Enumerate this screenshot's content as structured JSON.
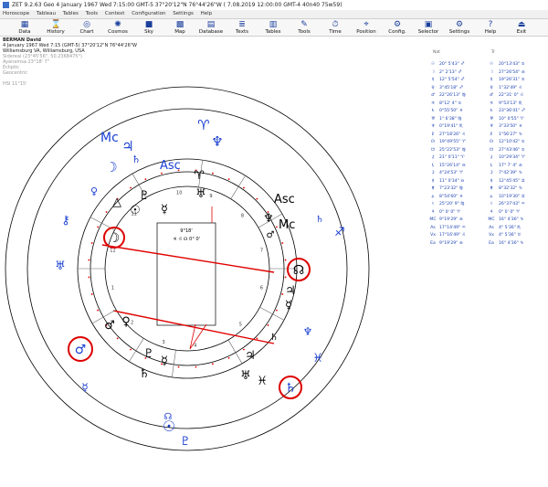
{
  "window": {
    "title": "ZET 9.2.63 Geo    4 January 1967  Wed    7:15:00 GMT-5 37°20'12\"N  76°44'26\"W   ( 7.08.2019  12:00:00 GMT-4 40n40 75w59)"
  },
  "menu": [
    "Horoscope",
    "Tableau",
    "Tables",
    "Tools",
    "Context",
    "Configuration",
    "Settings",
    "Help"
  ],
  "toolbar": [
    {
      "label": "Data",
      "icon": "data-icon",
      "glyph": "▦"
    },
    {
      "label": "History",
      "icon": "history-icon",
      "glyph": "⌛"
    },
    {
      "label": "Chart",
      "icon": "chart-icon",
      "glyph": "◎"
    },
    {
      "label": "Cosmos",
      "icon": "cosmos-icon",
      "glyph": "✺"
    },
    {
      "label": "Sky",
      "icon": "sky-icon",
      "glyph": "■"
    },
    {
      "label": "Map",
      "icon": "map-icon",
      "glyph": "▩"
    },
    {
      "label": "Database",
      "icon": "database-icon",
      "glyph": "▤"
    },
    {
      "label": "Texts",
      "icon": "texts-icon",
      "glyph": "≣"
    },
    {
      "label": "Tables",
      "icon": "tables-icon",
      "glyph": "▥"
    },
    {
      "label": "Tools",
      "icon": "tools-icon",
      "glyph": "✎"
    },
    {
      "label": "Time",
      "icon": "time-icon",
      "glyph": "⏱"
    },
    {
      "label": "Position",
      "icon": "position-icon",
      "glyph": "⌖"
    },
    {
      "label": "Config.",
      "icon": "config-icon",
      "glyph": "⚙"
    },
    {
      "label": "Selector",
      "icon": "selector-icon",
      "glyph": "▣"
    },
    {
      "label": "Settings",
      "icon": "settings-icon",
      "glyph": "⚙"
    },
    {
      "label": "Help",
      "icon": "help-icon",
      "glyph": "?"
    },
    {
      "label": "Exit",
      "icon": "exit-icon",
      "glyph": "⏏"
    }
  ],
  "header": {
    "name": "BERMAN David",
    "line1": "4 January 1967  Wed   7:15 (GMT-5) 37°20'12\"N   76°44'26\"W",
    "line2": "Williamsburg VA, Williamsburg, USA",
    "sub1": "Sidereal (23°45'56\", 50.2368475°)",
    "sub2": "Ayanamsa 23°18' 7\"",
    "sub3": "Ecliptic",
    "sub4": "Geocentric",
    "sub5": "HSI  11°15'"
  },
  "chart": {
    "center_label": "9°18'",
    "center_glyphs": "♃ ♌ ☊  0° 0'",
    "houses": [
      "1",
      "2",
      "3",
      "4",
      "5",
      "6",
      "7",
      "8",
      "9",
      "10",
      "11",
      "12"
    ],
    "angles": {
      "mc_outer": "Mc",
      "asc_outer": "Asc",
      "asc_inner": "Asc",
      "mc_inner": "Mc"
    },
    "colors": {
      "planet": "#1a3fd0",
      "ring": "#000000",
      "aspect": "#e00000",
      "highlight": "#dd0000"
    }
  },
  "natal_header": "Nat",
  "transit_header": "Tr",
  "natal": [
    [
      "☉",
      "20° 5'43\" ♐"
    ],
    [
      "☽",
      "2° 2'13\" ♐"
    ],
    [
      "☿",
      "12° 5'54\" ♐"
    ],
    [
      "♀",
      "3°45'18\" ♐"
    ],
    [
      "♂",
      "22°26'13\" ♍"
    ],
    [
      "♃",
      "8°12' 4\" ♋"
    ],
    [
      "♄",
      "0°55'50\" ♓"
    ],
    [
      "♅",
      "1° 6'38\" ♍"
    ],
    [
      "♆",
      "0°19'41\" ♏"
    ],
    [
      "♇",
      "27°18'26\" ♌"
    ],
    [
      "☊",
      "19°49'55\" ♈"
    ],
    [
      "☋",
      "25°22'53\" ♍"
    ],
    [
      "⚷",
      "21° 0'11\" ♈"
    ],
    [
      "⚸",
      "15°26'14\" ♎"
    ],
    [
      "⚳",
      "4°24'53\" ♈"
    ],
    [
      "⚴",
      "11° 0'34\" ♎"
    ],
    [
      "⚵",
      "7°23'32\" ♍"
    ],
    [
      "⚶",
      "8°54'60\" ♓"
    ],
    [
      "⚕",
      "25°20' 9\" ♍"
    ],
    [
      "⚘",
      "0° 0' 0\" ♈"
    ],
    [
      "MC",
      "9°19'29\" ♎"
    ],
    [
      "As",
      "17°14'49\" ♒"
    ],
    [
      "Vx",
      "17°16'49\" ♌"
    ],
    [
      "Ea",
      "9°19'29\" ♎"
    ]
  ],
  "transit": [
    [
      "☉",
      "20°13'43\" ♋"
    ],
    [
      "☽",
      "27°26'54\" ♎"
    ],
    [
      "☿",
      "19°26'31\" ♋"
    ],
    [
      "♀",
      "1°32'49\" ♌"
    ],
    [
      "♂",
      "22°31' 0\" ♌"
    ],
    [
      "♃",
      "9°53'13\" ♏"
    ],
    [
      "♄",
      "23°36'41\" ♐"
    ],
    [
      "♅",
      "10° 0'55\" ♈"
    ],
    [
      "♆",
      "3°33'50\" ♓"
    ],
    [
      "♇",
      "1°56'27\" ♑"
    ],
    [
      "☊",
      "12°10'42\" ♋"
    ],
    [
      "☋",
      "27°43'46\" ♋"
    ],
    [
      "⚷",
      "10°29'34\" ♈"
    ],
    [
      "⚸",
      "17° 7' 4\" ♎"
    ],
    [
      "⚳",
      "7°42'39\" ♑"
    ],
    [
      "⚴",
      "12°45'45\" ♊"
    ],
    [
      "⚵",
      "8°32'32\" ♑"
    ],
    [
      "⚶",
      "10°19'30\" ♊"
    ],
    [
      "⚕",
      "26°37'43\" ♒"
    ],
    [
      "⚘",
      "0° 0' 0\" ♈"
    ],
    [
      "MC",
      "16° 4'36\" ♑"
    ],
    [
      "As",
      "4° 5'36\" ♏"
    ],
    [
      "Vx",
      "4° 5'36\" ♉"
    ],
    [
      "Ea",
      "16° 4'36\" ♑"
    ]
  ]
}
